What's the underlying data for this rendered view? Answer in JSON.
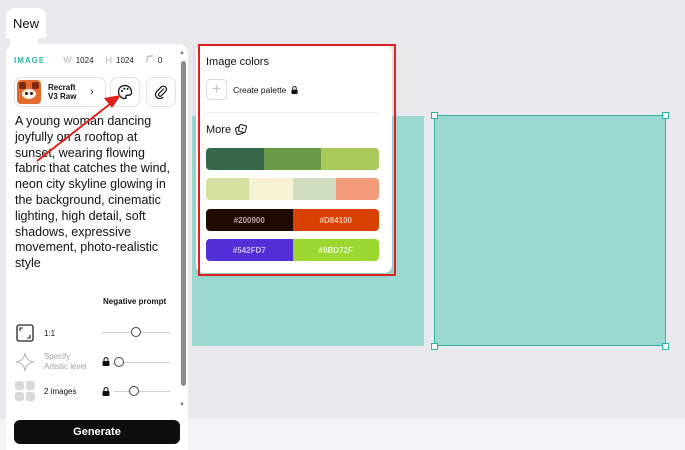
{
  "tab": {
    "label": "New"
  },
  "panel": {
    "type_label": "IMAGE",
    "width_key": "W",
    "width_value": "1024",
    "height_key": "H",
    "height_value": "1024",
    "radius_value": "0",
    "model": {
      "name_line1": "Recraft",
      "name_line2": "V3 Raw",
      "chevron": "›"
    },
    "prompt": "A young woman dancing joyfully on a rooftop at sunset, wearing flowing fabric that catches the wind, neon city skyline glowing in the background, cinematic lighting, high detail, soft shadows, expressive movement, photo-realistic style",
    "negative_prompt_label": "Negative prompt",
    "options": {
      "aspect_label": "1:1",
      "artistic_label_line1": "Specify",
      "artistic_label_line2": "Artistic level",
      "count_label": "2 images"
    },
    "generate_label": "Generate"
  },
  "popover": {
    "title": "Image colors",
    "create_label": "Create palette",
    "more_label": "More",
    "palettes": [
      {
        "swatches": [
          {
            "color": "#35694a",
            "label": ""
          },
          {
            "color": "#6a9a48",
            "label": ""
          },
          {
            "color": "#a9c95a",
            "label": ""
          }
        ]
      },
      {
        "swatches": [
          {
            "color": "#d6e0a1",
            "label": ""
          },
          {
            "color": "#f6f2d3",
            "label": ""
          },
          {
            "color": "#cfdcbd",
            "label": ""
          },
          {
            "color": "#f39c7a",
            "label": ""
          }
        ]
      },
      {
        "swatches": [
          {
            "color": "#200900",
            "label": "#200900",
            "text_color": "#b9a9a0"
          },
          {
            "color": "#D84100",
            "label": "#D84100",
            "text_color": "#f3c7b0"
          }
        ]
      },
      {
        "swatches": [
          {
            "color": "#542FD7",
            "label": "#542FD7",
            "text_color": "#c9bdf3"
          },
          {
            "color": "#9BD72F",
            "label": "#9BD72F",
            "text_color": "#e7f5c7"
          }
        ]
      }
    ]
  },
  "colors": {
    "accent": "#2cb2a5",
    "canvas_frame": "#9ad8d1",
    "highlight": "#e02020"
  }
}
